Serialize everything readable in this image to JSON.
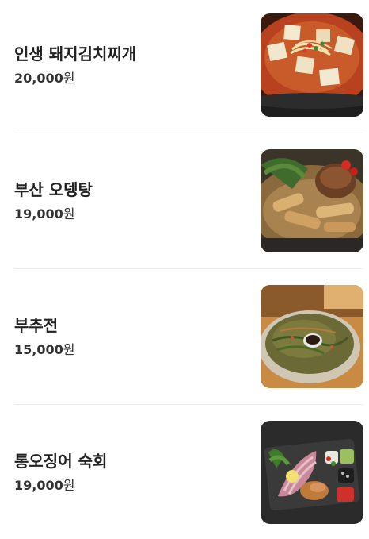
{
  "menu": {
    "currency_suffix": "원",
    "items": [
      {
        "name": "인생 돼지김치찌개",
        "price": "20,000",
        "photo_icon": "kimchi-stew-photo"
      },
      {
        "name": "부산 오뎅탕",
        "price": "19,000",
        "photo_icon": "fishcake-soup-photo"
      },
      {
        "name": "부추전",
        "price": "15,000",
        "photo_icon": "chive-pancake-photo"
      },
      {
        "name": "통오징어 숙회",
        "price": "19,000",
        "photo_icon": "squid-sashimi-photo"
      }
    ]
  }
}
